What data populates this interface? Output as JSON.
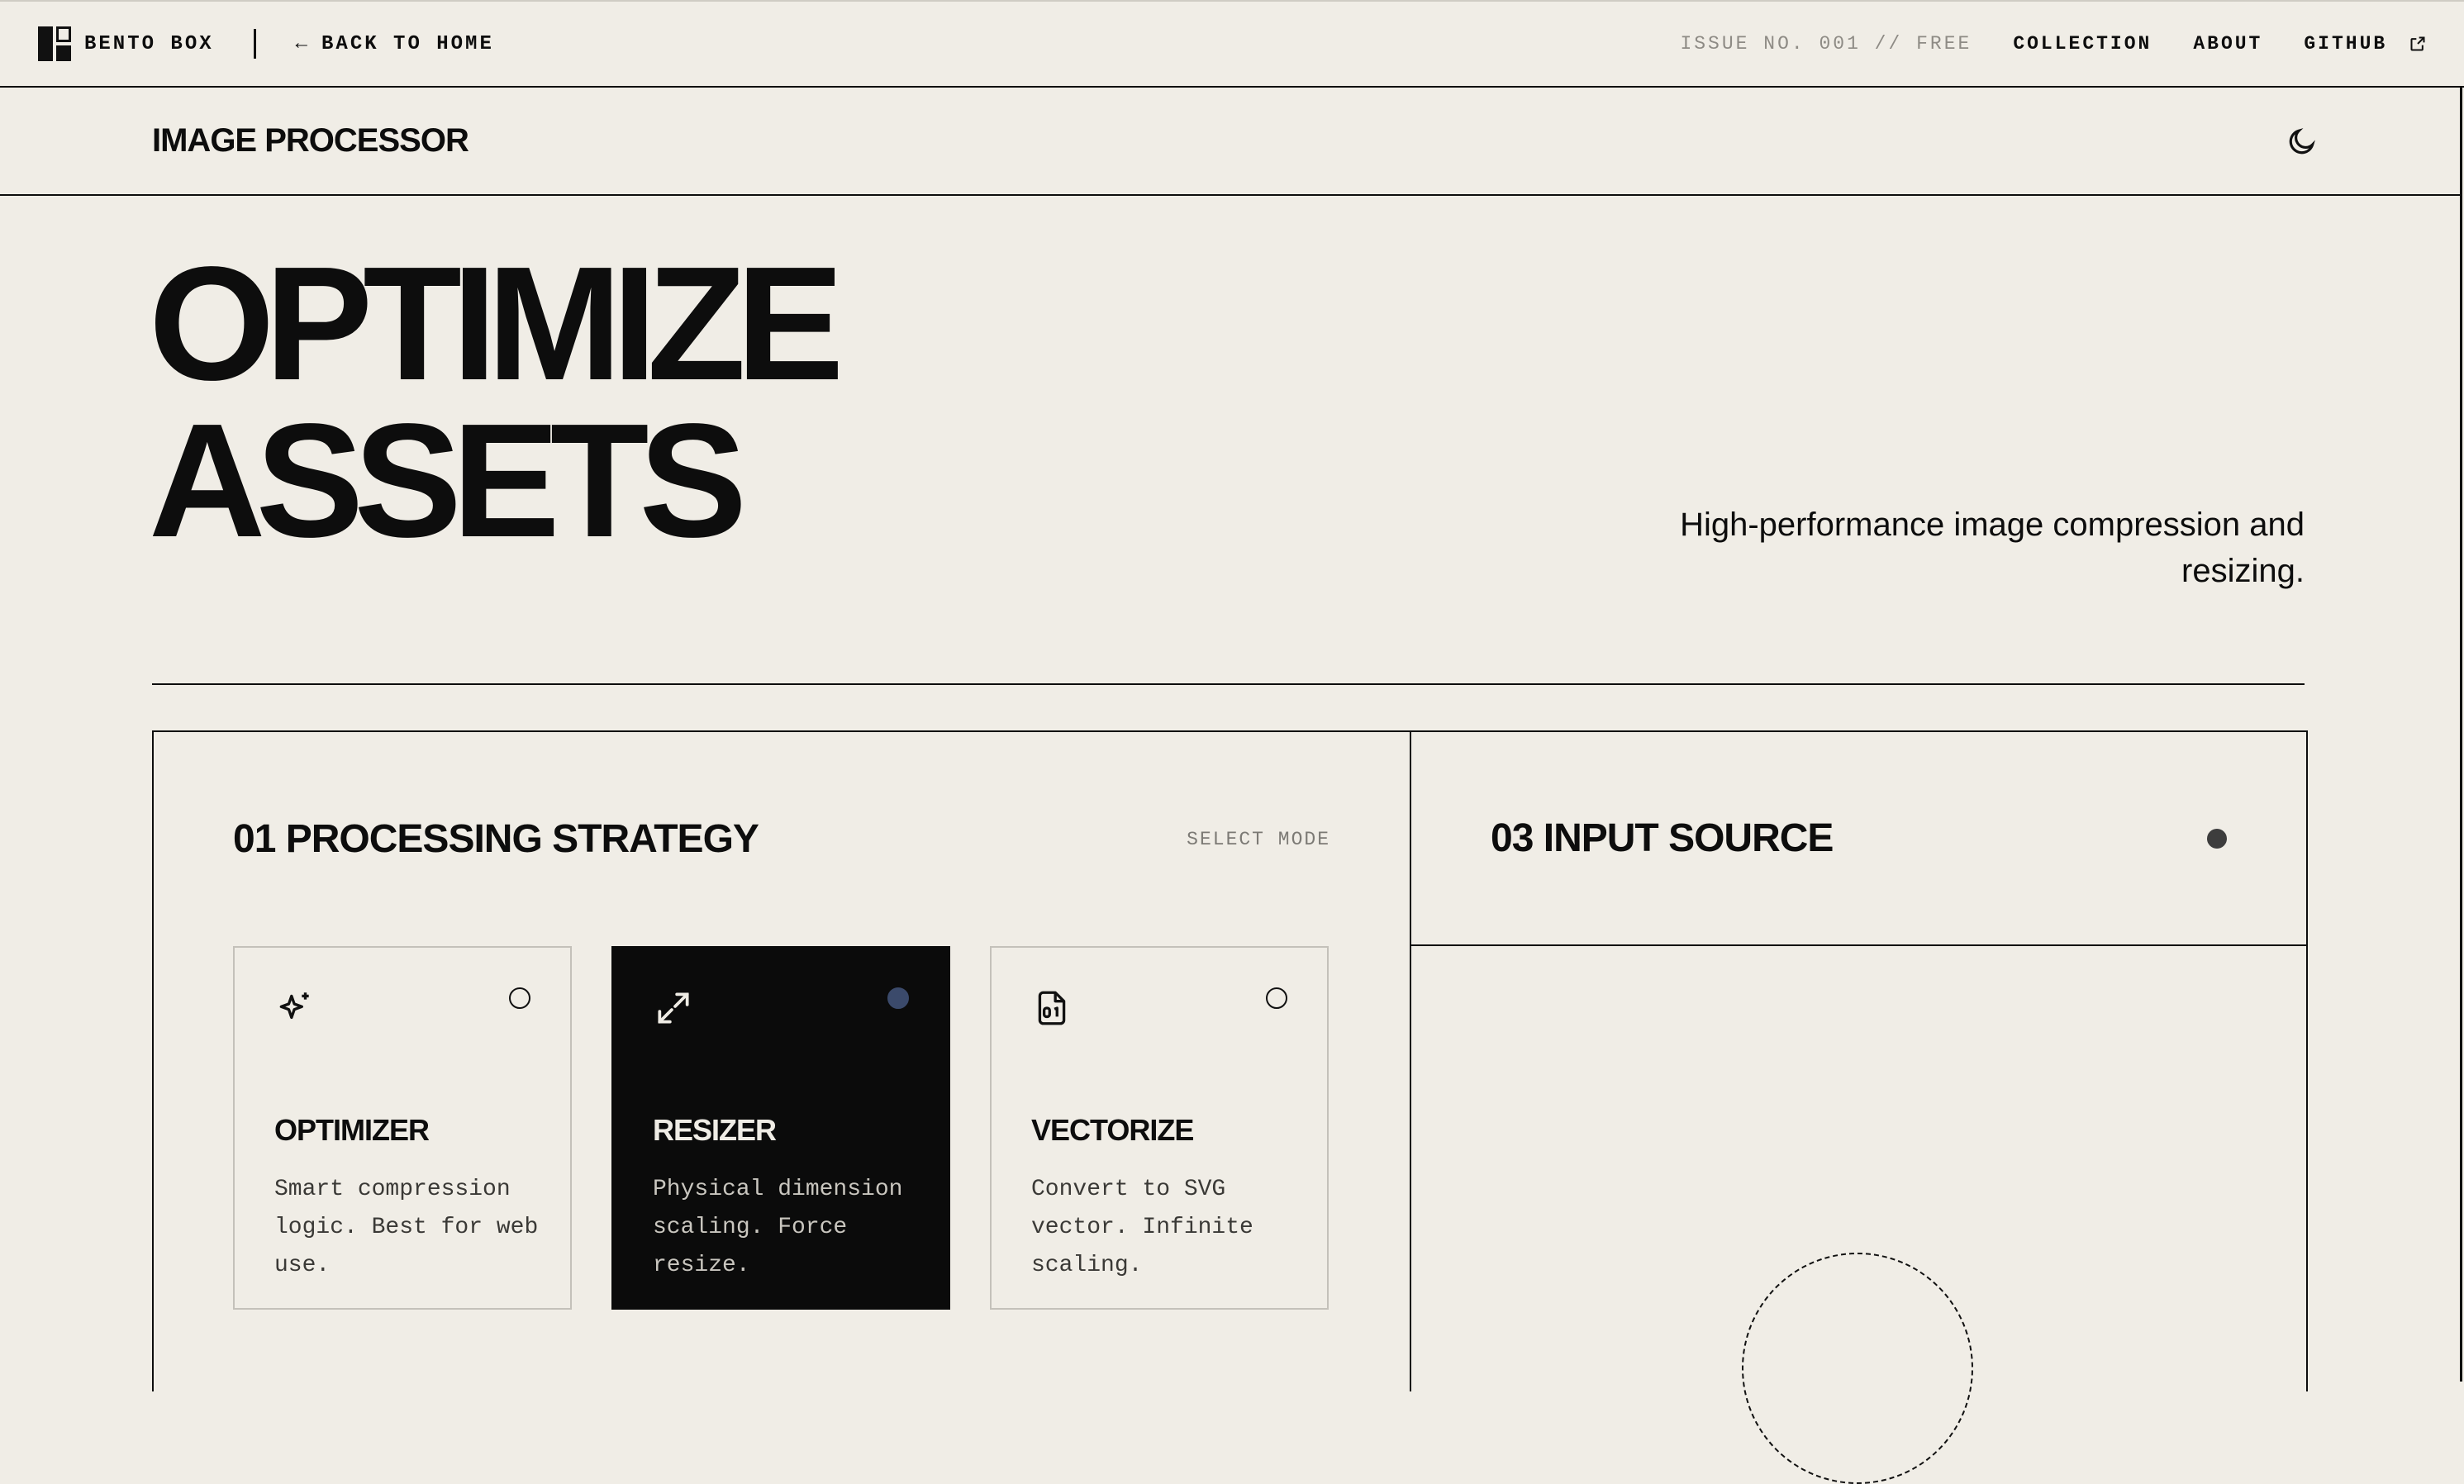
{
  "topbar": {
    "brand": "BENTO BOX",
    "back_label": "BACK TO HOME",
    "issue": "ISSUE NO. 001 // FREE",
    "nav": [
      "COLLECTION",
      "ABOUT",
      "GITHUB"
    ]
  },
  "app": {
    "title": "IMAGE PROCESSOR"
  },
  "hero": {
    "line1": "OPTIMIZE",
    "line2": "ASSETS",
    "subtitle": "High-performance image compression and resizing."
  },
  "strategy": {
    "title": "01 PROCESSING STRATEGY",
    "hint": "SELECT MODE",
    "selected": "RESIZER",
    "cards": [
      {
        "title": "OPTIMIZER",
        "desc": "Smart compression logic. Best for web use.",
        "icon": "sparkles-icon"
      },
      {
        "title": "RESIZER",
        "desc": "Physical dimension scaling. Force resize.",
        "icon": "expand-arrows-icon"
      },
      {
        "title": "VECTORIZE",
        "desc": "Convert to SVG vector. Infinite scaling.",
        "icon": "binary-file-icon"
      }
    ]
  },
  "input": {
    "title": "03 INPUT SOURCE"
  },
  "colors": {
    "background": "#f0ede6",
    "ink": "#0d0d0d",
    "active_card": "#0b0b0b",
    "active_radio": "#3b4a6b",
    "muted": "#8e8b85"
  }
}
